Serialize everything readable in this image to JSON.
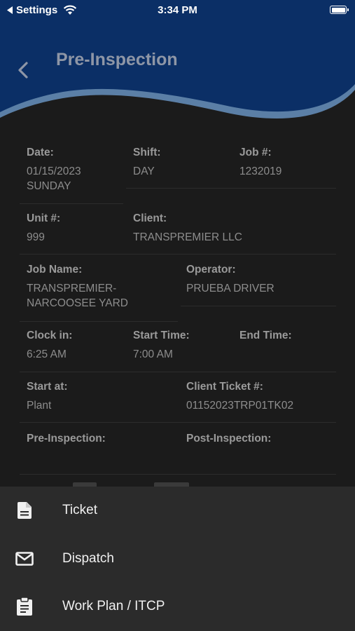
{
  "status_bar": {
    "back_app": "Settings",
    "time": "3:34 PM"
  },
  "header": {
    "title": "Pre-Inspection",
    "back_icon": "chevron-left-icon",
    "background": "#0b2f66"
  },
  "details": {
    "date": {
      "label": "Date:",
      "value": "01/15/2023\nSUNDAY"
    },
    "shift": {
      "label": "Shift:",
      "value": "DAY"
    },
    "job_number": {
      "label": "Job #:",
      "value": "1232019"
    },
    "unit_number": {
      "label": "Unit #:",
      "value": "999"
    },
    "client": {
      "label": "Client:",
      "value": "TRANSPREMIER LLC"
    },
    "job_name": {
      "label": "Job Name:",
      "value": "TRANSPREMIER-\nNARCOOSEE YARD"
    },
    "operator": {
      "label": "Operator:",
      "value": "PRUEBA DRIVER"
    },
    "clock_in": {
      "label": "Clock in:",
      "value": "6:25 AM"
    },
    "start_time": {
      "label": "Start Time:",
      "value": "7:00 AM"
    },
    "end_time": {
      "label": "End Time:",
      "value": ""
    },
    "start_at": {
      "label": "Start at:",
      "value": "Plant"
    },
    "client_ticket": {
      "label": "Client Ticket #:",
      "value": "01152023TRP01TK02"
    },
    "pre_inspection": {
      "label": "Pre-Inspection:",
      "value": ""
    },
    "post_inspection": {
      "label": "Post-Inspection:",
      "value": ""
    }
  },
  "menu": {
    "items": [
      {
        "label": "Ticket",
        "icon": "document-icon"
      },
      {
        "label": "Dispatch",
        "icon": "mail-icon"
      },
      {
        "label": "Work Plan / ITCP",
        "icon": "clipboard-icon"
      }
    ]
  }
}
